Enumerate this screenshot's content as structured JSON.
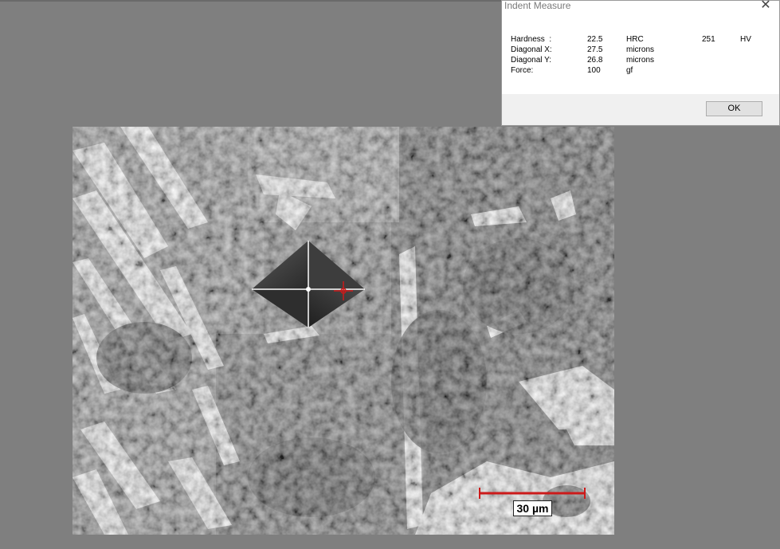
{
  "dialog": {
    "title": "Indent Measure",
    "close_glyph": "✕",
    "rows": [
      {
        "label": "Hardness  :",
        "value": "22.5",
        "unit": "HRC",
        "value2": "251",
        "unit2": "HV"
      },
      {
        "label": "Diagonal X:",
        "value": "27.5",
        "unit": "microns"
      },
      {
        "label": "Diagonal Y:",
        "value": "26.8",
        "unit": "microns"
      },
      {
        "label": "Force:",
        "value": "100",
        "unit": "gf"
      }
    ],
    "ok_label": "OK"
  },
  "image": {
    "scale_bar_label": "30 µm",
    "scale_bar_color": "#cc1a1a",
    "cursor_color": "#cc1a1a",
    "cursor_icon": "crosshair-icon"
  }
}
